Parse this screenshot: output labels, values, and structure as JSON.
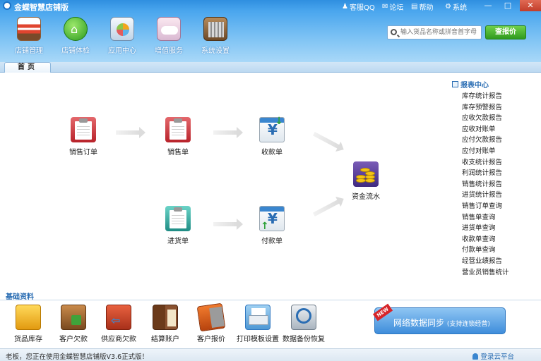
{
  "window": {
    "title": "金蝶智慧店铺版",
    "links": [
      {
        "label": "客服QQ",
        "icon": "qq-icon"
      },
      {
        "label": "论坛",
        "icon": "forum-icon"
      },
      {
        "label": "帮助",
        "icon": "help-icon"
      },
      {
        "label": "系统",
        "icon": "gear-icon"
      }
    ],
    "controls": {
      "minimize": "—",
      "maximize": "□",
      "close": "✕"
    }
  },
  "toolbar": [
    {
      "label": "店铺管理",
      "icon": "store-icon"
    },
    {
      "label": "店铺体检",
      "icon": "home-check-icon"
    },
    {
      "label": "应用中心",
      "icon": "app-center-icon"
    },
    {
      "label": "增值服务",
      "icon": "cloud-service-icon"
    },
    {
      "label": "系统设置",
      "icon": "toolbox-icon"
    }
  ],
  "search": {
    "placeholder": "输入货品名称或拼音首字母",
    "button": "查报价"
  },
  "tabs": [
    {
      "label": "首页",
      "active": true
    }
  ],
  "flow": {
    "sales_order": "销售订单",
    "sales": "销售单",
    "receipt": "收款单",
    "purchase": "进货单",
    "payment": "付款单",
    "cash_flow": "资金流水"
  },
  "reports": {
    "title": "报表中心",
    "items": [
      "库存统计报告",
      "库存预警报告",
      "应收欠款报告",
      "应收对账单",
      "应付欠款报告",
      "应付对账单",
      "收支统计报告",
      "利润统计报告",
      "销售统计报告",
      "进货统计报告",
      "销售订单查询",
      "销售单查询",
      "进货单查询",
      "收款单查询",
      "付款单查询",
      "经营业绩报告",
      "营业员销售统计"
    ]
  },
  "basic": {
    "title": "基础资料",
    "items": [
      {
        "label": "货品库存",
        "icon": "goods-stock-icon"
      },
      {
        "label": "客户欠款",
        "icon": "customer-debt-icon"
      },
      {
        "label": "供应商欠款",
        "icon": "supplier-debt-icon"
      },
      {
        "label": "结算账户",
        "icon": "account-book-icon"
      },
      {
        "label": "客户报价",
        "icon": "price-tag-icon"
      },
      {
        "label": "打印模板设置",
        "icon": "printer-icon"
      },
      {
        "label": "数据备份恢复",
        "icon": "backup-restore-icon"
      }
    ]
  },
  "sync": {
    "badge": "NEW",
    "label": "网络数据同步",
    "sub": "(支持连锁经营)"
  },
  "status": {
    "text": "老板，您正在使用金蝶智慧店铺版V3.6正式版！",
    "cloud_login": "登录云平台"
  },
  "colors": {
    "header_top": "#2f8fe0",
    "accent_green": "#2f9a1e",
    "link_blue": "#2a6db3",
    "close_red": "#c23d2a"
  }
}
